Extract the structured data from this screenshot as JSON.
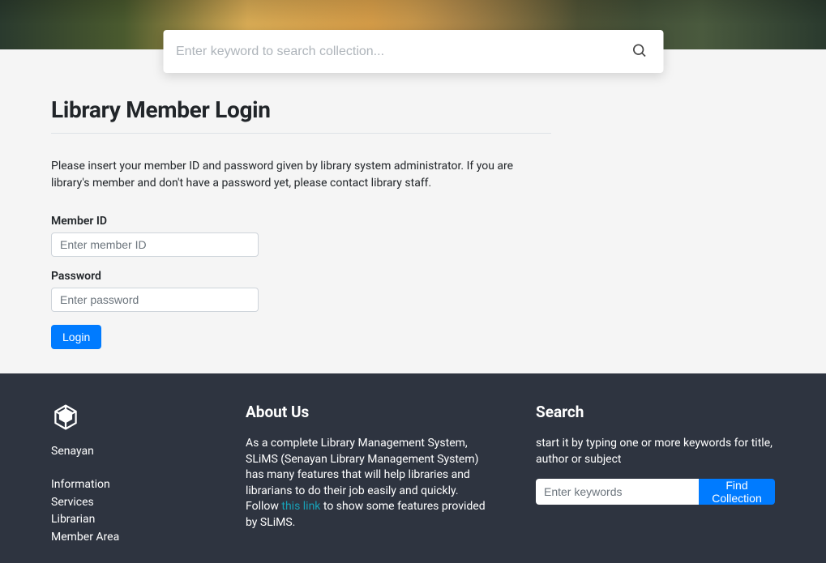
{
  "header": {
    "search_placeholder": "Enter keyword to search collection..."
  },
  "main": {
    "title": "Library Member Login",
    "instructions": "Please insert your member ID and password given by library system administrator. If you are library's member and don't have a password yet, please contact library staff.",
    "member_id_label": "Member ID",
    "member_id_placeholder": "Enter member ID",
    "password_label": "Password",
    "password_placeholder": "Enter password",
    "login_button": "Login"
  },
  "footer": {
    "brand": "Senayan",
    "links": [
      "Information",
      "Services",
      "Librarian",
      "Member Area"
    ],
    "about": {
      "heading": "About Us",
      "text_before": "As a complete Library Management System, SLiMS (Senayan Library Management System) has many features that will help libraries and librarians to do their job easily and quickly. Follow ",
      "link_text": "this link",
      "text_after": " to show some features provided by SLiMS."
    },
    "search": {
      "heading": "Search",
      "text": "start it by typing one or more keywords for title, author or subject",
      "placeholder": "Enter keywords",
      "button": "Find Collection"
    }
  }
}
